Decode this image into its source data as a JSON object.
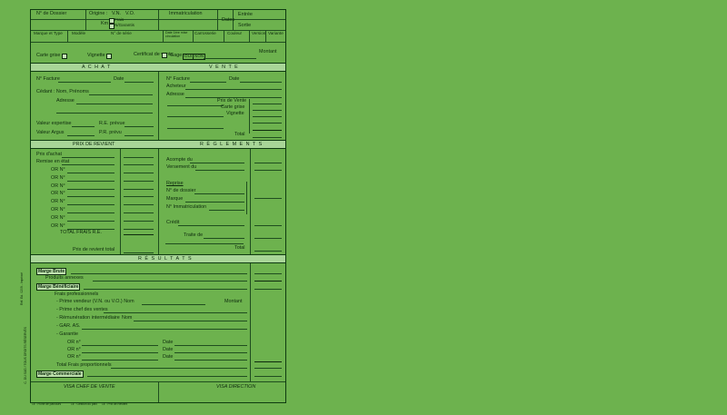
{
  "header": {
    "dossier": "N° de Dossier",
    "origine": "Origine :",
    "vn": "V.N.",
    "vo": "V.O.",
    "km": "Km",
    "frais": "Frais",
    "ngarantis": "N/Garantis",
    "immat": "Immatriculation",
    "dates": "Dates",
    "entree": "Entrée",
    "sortie": "Sortie",
    "marque_type": "Marque et Type",
    "modele": "Modèle",
    "n_serie": "N° de série",
    "date_circ": "Date 1ère mise circulation",
    "carrosserie": "Carrosserie",
    "couleur": "Couleur",
    "version": "Version",
    "variante": "Variante"
  },
  "docs": {
    "carte_grise": "Carte grise",
    "vignette": "Vignette",
    "certificat": "Certificat de vente",
    "gage": "Gage :",
    "oui": "OUI",
    "non": "NON",
    "montant": "Montant"
  },
  "achat": {
    "title": "A C H A T",
    "facture": "N° Facture",
    "date": "Date",
    "cedant": "Cédant : Nom, Prénoms",
    "adresse": "Adresse",
    "valeur_exp": "Valeur expertise",
    "re_prevue": "R.E. prévue",
    "valeur_argus": "Valeur Argus",
    "pr_prevu": "P.R. prévu"
  },
  "vente": {
    "title": "V E N T E",
    "facture": "N° Facture",
    "date": "Date",
    "acheteur": "Acheteur",
    "adresse": "Adresse",
    "prix_vente": "Prix de Vente",
    "carte_grise": "Carte grise",
    "vignette": "Vignette",
    "total": "Total"
  },
  "prix_revient": {
    "title": "PRIX DE REVIENT",
    "prix_achat": "Prix d'achat",
    "remise": "Remise en état",
    "or_label": "OR N°",
    "or_count": 8,
    "total_frais": "TOTAL FRAIS R.E.",
    "prix_total": "Prix de revient total"
  },
  "reglements": {
    "title": "R È G L E M E N T S",
    "acompte": "Acompte du",
    "versement": "Versement du",
    "reprise": "Reprise",
    "n_dossier": "N° de dossier",
    "marque": "Marque",
    "immat": "N° Immatriculation",
    "credit": "Crédit",
    "traite": "Traite de",
    "total": "Total"
  },
  "resultats": {
    "title": "R É S U L T A T S",
    "marge_brute": "Marge Brute",
    "produits": "Produits annexes",
    "marge_benef": "Marge Bénéficiaire",
    "frais_pro": "Frais professionnels",
    "prime_vendeur": "- Prime vendeur (V.N. ou V.O.) Nom",
    "montant": "Montant",
    "prime_chef": "- Prime chef des ventes",
    "remuneration": "- Rémunération intermédiaire",
    "nom": "Nom",
    "gar": "- GAR. AS.",
    "garantie": "- Garantie",
    "or_n": "OR n°",
    "date": "Date",
    "total_frais": "Total Frais proportionnels",
    "marge_comm": "Marge Commerciale"
  },
  "visa": {
    "chef": "VISA CHEF DE VENTE",
    "direction": "VISA DIRECTION"
  },
  "spine": {
    "ref": "Réf. Ed. 0209 - Imprimé",
    "edition": "C. DU SUD / TOUS DROITS RÉSERVÉS"
  },
  "footer": {
    "a": "1E : Fiche de parcours",
    "b": "1E : Gestion du parc",
    "c": "1E : Prix de Revient"
  }
}
